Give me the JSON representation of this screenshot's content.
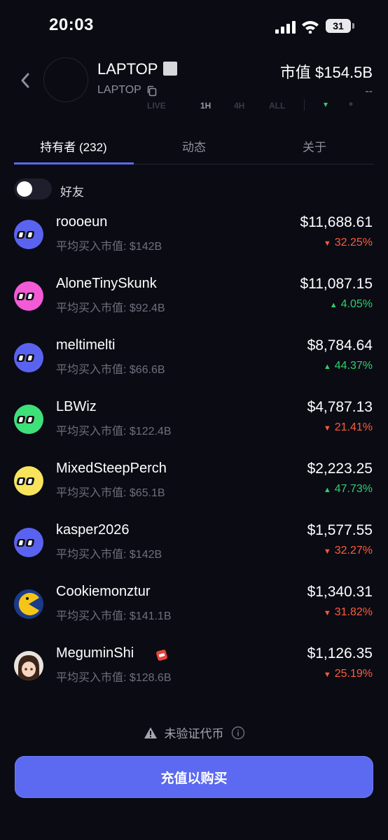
{
  "status_bar": {
    "time": "20:03",
    "battery": "31"
  },
  "header": {
    "token_name": "LAPTOP",
    "token_ticker": "LAPTOP",
    "market_cap": "市值 $154.5B",
    "change": "--"
  },
  "ghost_tabs": [
    "LIVE",
    "1H",
    "4H",
    "ALL"
  ],
  "tabs": [
    {
      "label": "持有者 (232)",
      "active": true
    },
    {
      "label": "动态",
      "active": false
    },
    {
      "label": "关于",
      "active": false
    }
  ],
  "friends_toggle": {
    "label": "好友",
    "on": false
  },
  "holders": [
    {
      "name": "roooeun",
      "avg_label": "平均买入市值: $142B",
      "value": "$11,688.61",
      "change": "32.25%",
      "direction": "down",
      "avatar_color": "#5a63f0"
    },
    {
      "name": "AloneTinySkunk",
      "avg_label": "平均买入市值: $92.4B",
      "value": "$11,087.15",
      "change": "4.05%",
      "direction": "up",
      "avatar_color": "#f25ad6"
    },
    {
      "name": "meltimelti",
      "avg_label": "平均买入市值: $66.6B",
      "value": "$8,784.64",
      "change": "44.37%",
      "direction": "up",
      "avatar_color": "#5a63f0"
    },
    {
      "name": "LBWiz",
      "avg_label": "平均买入市值: $122.4B",
      "value": "$4,787.13",
      "change": "21.41%",
      "direction": "down",
      "avatar_color": "#3ee07a"
    },
    {
      "name": "MixedSteepPerch",
      "avg_label": "平均买入市值: $65.1B",
      "value": "$2,223.25",
      "change": "47.73%",
      "direction": "up",
      "avatar_color": "#f7e45c"
    },
    {
      "name": "kasper2026",
      "avg_label": "平均买入市值: $142B",
      "value": "$1,577.55",
      "change": "32.27%",
      "direction": "down",
      "avatar_color": "#5a63f0"
    },
    {
      "name": "Cookiemonztur",
      "avg_label": "平均买入市值: $141.1B",
      "value": "$1,340.31",
      "change": "31.82%",
      "direction": "down",
      "avatar_color": "#1b3a8a"
    },
    {
      "name": "MeguminShi",
      "avg_label": "平均买入市值: $128.6B",
      "value": "$1,126.35",
      "change": "25.19%",
      "direction": "down",
      "avatar_color": "#6b4a3a"
    }
  ],
  "footer": {
    "unverified": "未验证代币",
    "buy_button": "充值以购买"
  },
  "colors": {
    "accent": "#5b6af0",
    "up": "#2ed06e",
    "down": "#ff5b3a",
    "background": "#0b0b14"
  }
}
